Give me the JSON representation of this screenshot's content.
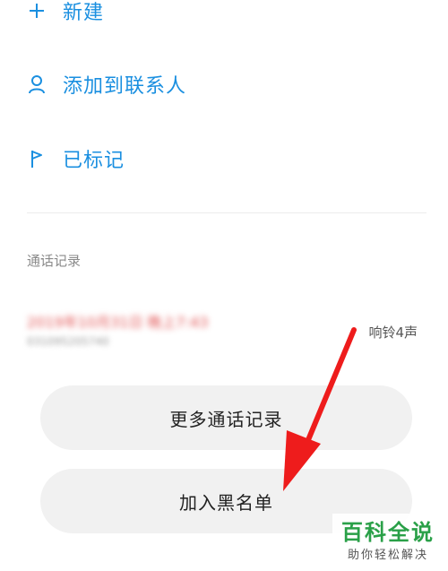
{
  "menu": {
    "items": [
      {
        "label": "新建",
        "icon": "plus-icon"
      },
      {
        "label": "添加到联系人",
        "icon": "person-icon"
      },
      {
        "label": "已标记",
        "icon": "flag-icon"
      }
    ]
  },
  "call_log": {
    "title": "通话记录",
    "entry": {
      "time": "2019年10月31日 晚上7:43",
      "number": "03109520574​0",
      "status": "响铃4声"
    }
  },
  "actions": {
    "more_records": "更多通话记录",
    "add_blacklist": "加入黑名单"
  },
  "watermark": {
    "title": "百科全说",
    "subtitle": "助你轻松解决"
  },
  "colors": {
    "accent": "#1a8fe0",
    "arrow": "#ee1c1c",
    "watermark": "#2aa048"
  }
}
